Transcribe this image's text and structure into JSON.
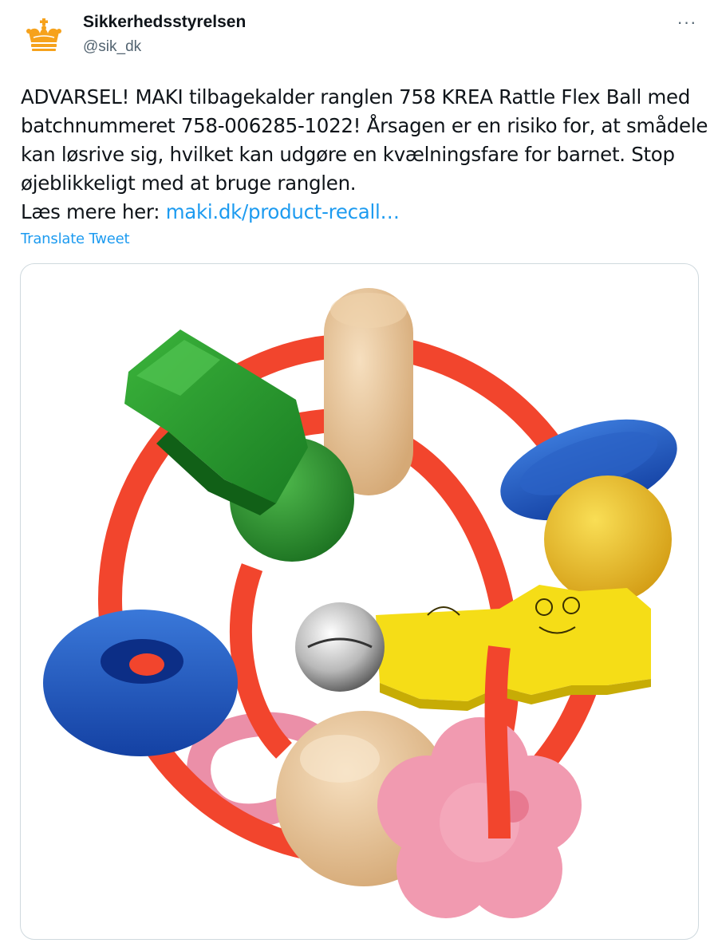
{
  "author": {
    "name": "Sikkerhedsstyrelsen",
    "handle": "@sik_dk",
    "avatar_icon": "crown-icon",
    "avatar_color": "#f6a21c"
  },
  "menu": {
    "more_label": "···",
    "more_icon": "more-dots-icon"
  },
  "tweet": {
    "lines": [
      "ADVARSEL! MAKI tilbagekalder ranglen 758 KREA Rattle Flex Ball med",
      "batchnummeret 758-006285-1022! Årsagen er en risiko for, at smådele",
      "kan løsrive sig, hvilket kan udgøre en kvælningsfare for barnet. Stop",
      "øjeblikkeligt med at bruge ranglen."
    ],
    "read_more_prefix": "Læs mere her: ",
    "link_text": "maki.dk/product-recall…",
    "link_color": "#1d9bf0"
  },
  "translate_label": "Translate Tweet",
  "media": {
    "subject": "rattle-toy-photo"
  }
}
